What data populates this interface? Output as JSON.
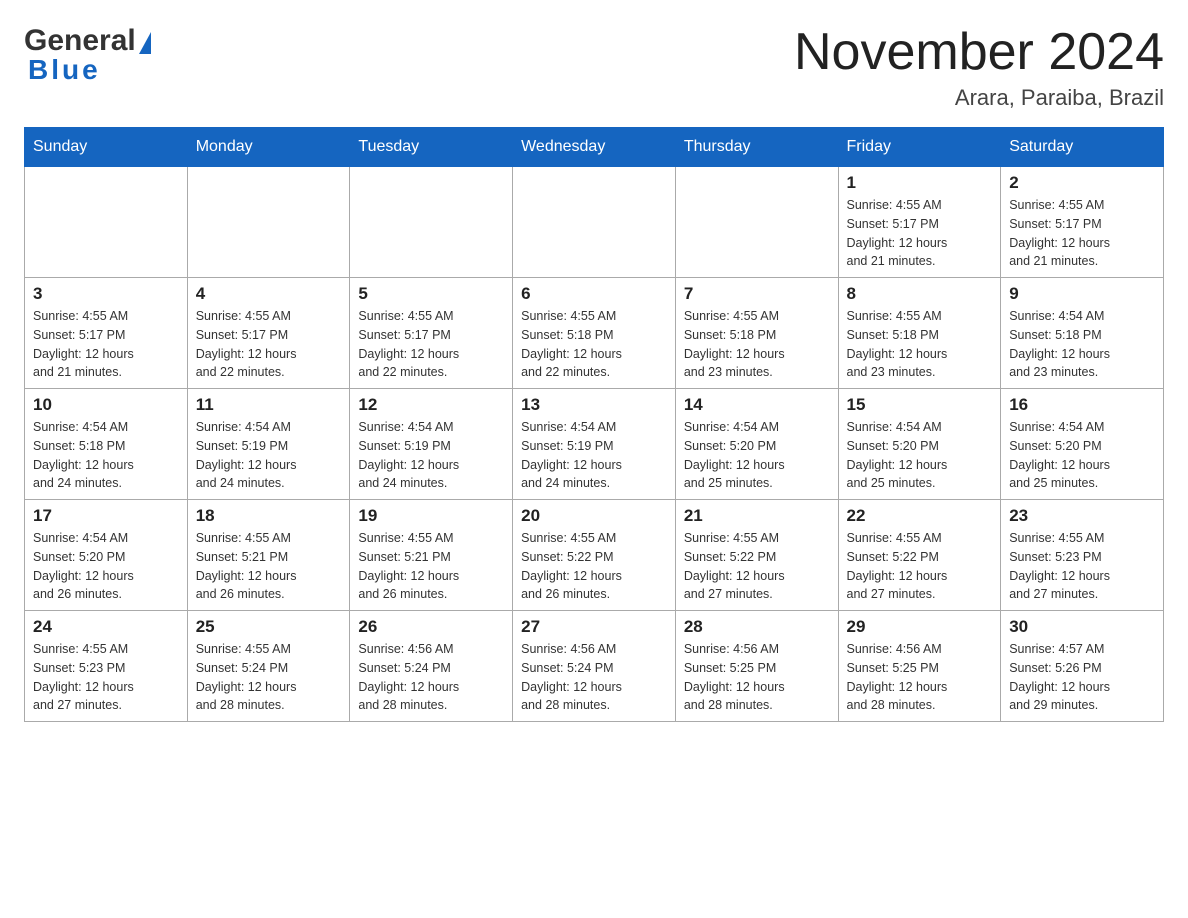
{
  "header": {
    "logo_general": "General",
    "logo_blue": "Blue",
    "month_title": "November 2024",
    "location": "Arara, Paraiba, Brazil"
  },
  "days_of_week": [
    "Sunday",
    "Monday",
    "Tuesday",
    "Wednesday",
    "Thursday",
    "Friday",
    "Saturday"
  ],
  "weeks": [
    [
      {
        "day": "",
        "info": ""
      },
      {
        "day": "",
        "info": ""
      },
      {
        "day": "",
        "info": ""
      },
      {
        "day": "",
        "info": ""
      },
      {
        "day": "",
        "info": ""
      },
      {
        "day": "1",
        "info": "Sunrise: 4:55 AM\nSunset: 5:17 PM\nDaylight: 12 hours\nand 21 minutes."
      },
      {
        "day": "2",
        "info": "Sunrise: 4:55 AM\nSunset: 5:17 PM\nDaylight: 12 hours\nand 21 minutes."
      }
    ],
    [
      {
        "day": "3",
        "info": "Sunrise: 4:55 AM\nSunset: 5:17 PM\nDaylight: 12 hours\nand 21 minutes."
      },
      {
        "day": "4",
        "info": "Sunrise: 4:55 AM\nSunset: 5:17 PM\nDaylight: 12 hours\nand 22 minutes."
      },
      {
        "day": "5",
        "info": "Sunrise: 4:55 AM\nSunset: 5:17 PM\nDaylight: 12 hours\nand 22 minutes."
      },
      {
        "day": "6",
        "info": "Sunrise: 4:55 AM\nSunset: 5:18 PM\nDaylight: 12 hours\nand 22 minutes."
      },
      {
        "day": "7",
        "info": "Sunrise: 4:55 AM\nSunset: 5:18 PM\nDaylight: 12 hours\nand 23 minutes."
      },
      {
        "day": "8",
        "info": "Sunrise: 4:55 AM\nSunset: 5:18 PM\nDaylight: 12 hours\nand 23 minutes."
      },
      {
        "day": "9",
        "info": "Sunrise: 4:54 AM\nSunset: 5:18 PM\nDaylight: 12 hours\nand 23 minutes."
      }
    ],
    [
      {
        "day": "10",
        "info": "Sunrise: 4:54 AM\nSunset: 5:18 PM\nDaylight: 12 hours\nand 24 minutes."
      },
      {
        "day": "11",
        "info": "Sunrise: 4:54 AM\nSunset: 5:19 PM\nDaylight: 12 hours\nand 24 minutes."
      },
      {
        "day": "12",
        "info": "Sunrise: 4:54 AM\nSunset: 5:19 PM\nDaylight: 12 hours\nand 24 minutes."
      },
      {
        "day": "13",
        "info": "Sunrise: 4:54 AM\nSunset: 5:19 PM\nDaylight: 12 hours\nand 24 minutes."
      },
      {
        "day": "14",
        "info": "Sunrise: 4:54 AM\nSunset: 5:20 PM\nDaylight: 12 hours\nand 25 minutes."
      },
      {
        "day": "15",
        "info": "Sunrise: 4:54 AM\nSunset: 5:20 PM\nDaylight: 12 hours\nand 25 minutes."
      },
      {
        "day": "16",
        "info": "Sunrise: 4:54 AM\nSunset: 5:20 PM\nDaylight: 12 hours\nand 25 minutes."
      }
    ],
    [
      {
        "day": "17",
        "info": "Sunrise: 4:54 AM\nSunset: 5:20 PM\nDaylight: 12 hours\nand 26 minutes."
      },
      {
        "day": "18",
        "info": "Sunrise: 4:55 AM\nSunset: 5:21 PM\nDaylight: 12 hours\nand 26 minutes."
      },
      {
        "day": "19",
        "info": "Sunrise: 4:55 AM\nSunset: 5:21 PM\nDaylight: 12 hours\nand 26 minutes."
      },
      {
        "day": "20",
        "info": "Sunrise: 4:55 AM\nSunset: 5:22 PM\nDaylight: 12 hours\nand 26 minutes."
      },
      {
        "day": "21",
        "info": "Sunrise: 4:55 AM\nSunset: 5:22 PM\nDaylight: 12 hours\nand 27 minutes."
      },
      {
        "day": "22",
        "info": "Sunrise: 4:55 AM\nSunset: 5:22 PM\nDaylight: 12 hours\nand 27 minutes."
      },
      {
        "day": "23",
        "info": "Sunrise: 4:55 AM\nSunset: 5:23 PM\nDaylight: 12 hours\nand 27 minutes."
      }
    ],
    [
      {
        "day": "24",
        "info": "Sunrise: 4:55 AM\nSunset: 5:23 PM\nDaylight: 12 hours\nand 27 minutes."
      },
      {
        "day": "25",
        "info": "Sunrise: 4:55 AM\nSunset: 5:24 PM\nDaylight: 12 hours\nand 28 minutes."
      },
      {
        "day": "26",
        "info": "Sunrise: 4:56 AM\nSunset: 5:24 PM\nDaylight: 12 hours\nand 28 minutes."
      },
      {
        "day": "27",
        "info": "Sunrise: 4:56 AM\nSunset: 5:24 PM\nDaylight: 12 hours\nand 28 minutes."
      },
      {
        "day": "28",
        "info": "Sunrise: 4:56 AM\nSunset: 5:25 PM\nDaylight: 12 hours\nand 28 minutes."
      },
      {
        "day": "29",
        "info": "Sunrise: 4:56 AM\nSunset: 5:25 PM\nDaylight: 12 hours\nand 28 minutes."
      },
      {
        "day": "30",
        "info": "Sunrise: 4:57 AM\nSunset: 5:26 PM\nDaylight: 12 hours\nand 29 minutes."
      }
    ]
  ]
}
